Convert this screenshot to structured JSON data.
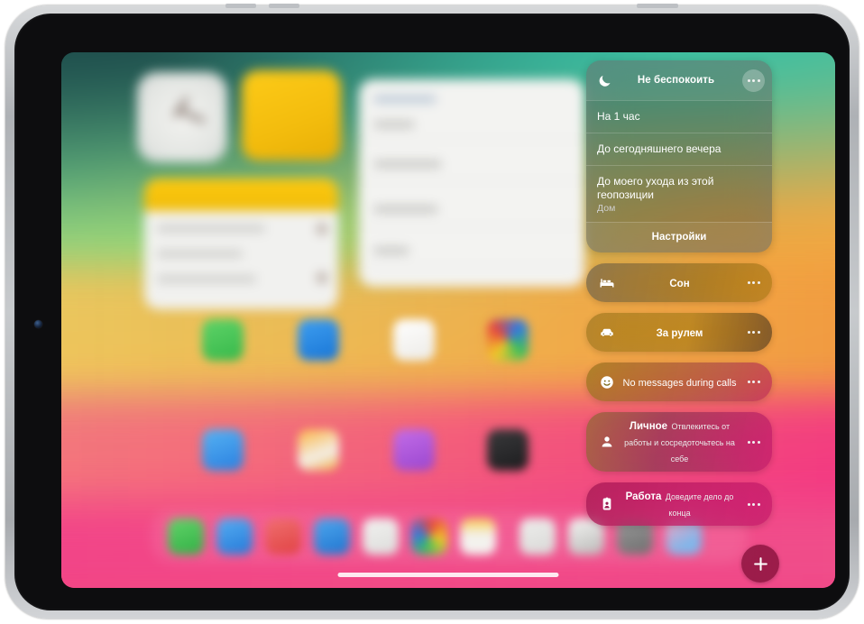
{
  "device": {
    "name": "tablet-device",
    "orientation": "landscape"
  },
  "focus_panel": {
    "dnd": {
      "icon": "moon-icon",
      "title": "Не беспокоить",
      "more_icon": "ellipsis-icon",
      "options": [
        {
          "label": "На 1 час",
          "sub": ""
        },
        {
          "label": "До сегодняшнего вечера",
          "sub": ""
        },
        {
          "label": "До моего ухода из этой геопозиции",
          "sub": "Дом"
        }
      ],
      "footer_label": "Настройки"
    },
    "modes": [
      {
        "icon": "bed-icon",
        "title": "Сон",
        "sub": "",
        "more_icon": "ellipsis-icon"
      },
      {
        "icon": "car-icon",
        "title": "За рулем",
        "sub": "",
        "more_icon": "ellipsis-icon"
      },
      {
        "icon": "smiley-icon",
        "title": "No messages during calls",
        "sub": "",
        "more_icon": "ellipsis-icon"
      },
      {
        "icon": "person-icon",
        "title": "Личное",
        "sub": "Отвлекитесь от работы и сосредоточьтесь на себе",
        "more_icon": "ellipsis-icon"
      },
      {
        "icon": "badge-icon",
        "title": "Работа",
        "sub": "Доведите дело до конца",
        "more_icon": "ellipsis-icon"
      }
    ]
  },
  "add_button": {
    "icon": "plus-icon",
    "label": "+"
  },
  "home_indicator": {
    "name": "home-indicator"
  },
  "colors": {
    "panel_bg": "#5c6060",
    "add_button_bg": "#7d0c34",
    "text_primary": "#ffffff",
    "text_secondary": "#cfcfcf"
  }
}
